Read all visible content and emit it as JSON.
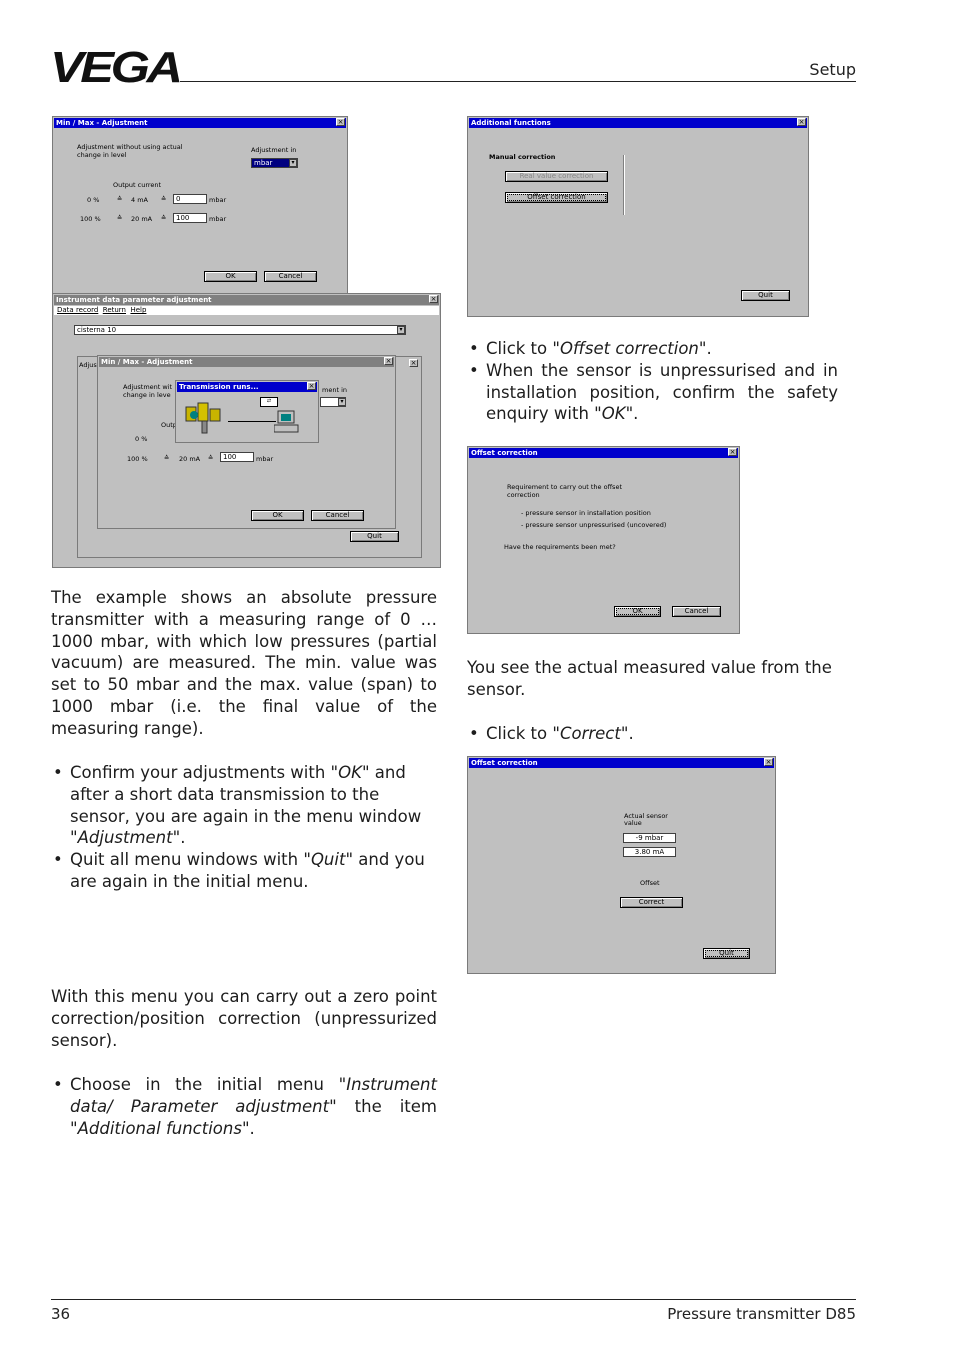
{
  "header": {
    "logo": "VEGA",
    "section": "Setup"
  },
  "footer": {
    "page_number": "36",
    "product": "Pressure transmitter D85"
  },
  "win_minmax_top": {
    "title": "Min / Max - Adjustment",
    "text_without": "Adjustment without using actual change in level",
    "adjustment_in_label": "Adjustment in",
    "unit_value": "mbar",
    "output_current": "Output current",
    "row0_pct": "0 %",
    "row0_ma": "4 mA",
    "row0_value": "0",
    "row0_unit": "mbar",
    "row1_pct": "100 %",
    "row1_ma": "20 mA",
    "row1_value": "100",
    "row1_unit": "mbar",
    "equiv": "≙",
    "ok": "OK",
    "cancel": "Cancel"
  },
  "win_instrument": {
    "title": "Instrument data parameter adjustment",
    "menu": [
      "Data record",
      "Return",
      "Help"
    ],
    "dropdown_value": "cisterna 10",
    "adjust_partial": "Adjus",
    "quit": "Quit"
  },
  "win_minmax_inner": {
    "title": "Min / Max - Adjustment",
    "text_without": "Adjustment wit change in leve",
    "adjustment_partial": "ment in",
    "out_partial": "Outp",
    "row0_pct": "0 %",
    "row1_pct": "100 %",
    "row1_ma": "20 mA",
    "row1_value": "100",
    "row1_unit": "mbar",
    "equiv": "≙",
    "ok": "OK",
    "cancel": "Cancel"
  },
  "win_transmission": {
    "title": "Transmission runs..."
  },
  "win_additional": {
    "title": "Additional functions",
    "manual_correction": "Manual correction",
    "real_value": "Real value correction",
    "offset_correction": "Offset correction",
    "quit": "Quit"
  },
  "win_offset1": {
    "title": "Offset correction",
    "req_line1": "Requirement to carry out the offset",
    "req_line2": "correction",
    "item1": "- pressure sensor in installation position",
    "item2": "- pressure sensor unpressurised (uncovered)",
    "question": "Have the requirements been met?",
    "ok": "OK",
    "cancel": "Cancel"
  },
  "win_offset2": {
    "title": "Offset correction",
    "actual_line1": "Actual sensor",
    "actual_line2": "value",
    "value_mbar": "-9 mbar",
    "value_ma": "3.80 mA",
    "offset": "Offset",
    "correct": "Correct",
    "quit": "Quit"
  },
  "left_col": {
    "p1": "The example shows an absolute pressure transmitter with a measuring range of 0 … 1000 mbar, with which low pressures (partial vacuum) are measured. The min. value was set to 50 mbar and the max. value (span) to 1000 mbar (i.e. the final value of the measuring range).",
    "b1_pre": "Confirm your adjustments with \"",
    "b1_em": "OK",
    "b1_mid": "\" and after a short data transmission to the sensor, you are again in the menu window \"",
    "b1_em2": "Adjustment",
    "b1_post": "\".",
    "b2_pre": "Quit all menu windows with \"",
    "b2_em": "Quit",
    "b2_post": "\" and you are again in the initial menu.",
    "p2": "With this menu you can carry out a zero point correction/position correction (unpressurized sensor).",
    "b3_pre": "Choose in the initial menu \"",
    "b3_em": "Instrument data/ Parameter adjustment",
    "b3_mid": "\" the item \"",
    "b3_em2": "Additional functions",
    "b3_post": "\"."
  },
  "right_col": {
    "b1_pre": "Click to \"",
    "b1_em": "Offset correction",
    "b1_post": "\".",
    "b2_pre": "When the sensor is unpressurised and in installation position, confirm the safety enquiry with \"",
    "b2_em": "OK",
    "b2_post": "\".",
    "p1": "You see the actual measured value from the sensor.",
    "b3_pre": "Click to \"",
    "b3_em": "Correct",
    "b3_post": "\"."
  }
}
